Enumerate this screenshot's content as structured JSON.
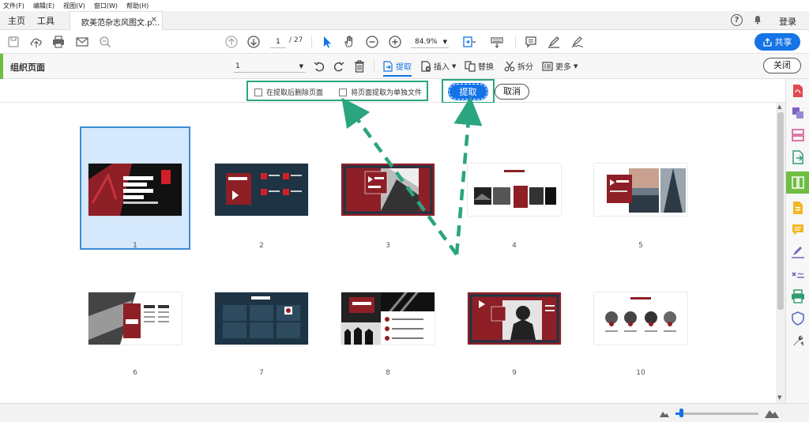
{
  "menu": [
    "文件(F)",
    "编辑(E)",
    "视图(V)",
    "窗口(W)",
    "帮助(H)"
  ],
  "tabs": {
    "home": "主页",
    "tools": "工具",
    "doc": "欧美范杂志风图文.p..."
  },
  "header": {
    "login": "登录"
  },
  "toolbar": {
    "page_current": "1",
    "page_total": "/ 27",
    "zoom": "84.9%",
    "share": "共享"
  },
  "organize": {
    "title": "组织页面",
    "page_select": "1",
    "tools": {
      "extract": "提取",
      "insert": "插入",
      "replace": "替换",
      "split": "拆分",
      "more": "更多"
    },
    "close": "关闭"
  },
  "extract_options": {
    "delete_after": "在提取后删除页面",
    "separate_files": "将页面提取为单独文件",
    "extract_btn": "提取",
    "cancel_btn": "取消"
  },
  "thumbnails": [
    "1",
    "2",
    "3",
    "4",
    "5",
    "6",
    "7",
    "8",
    "9",
    "10"
  ],
  "colors": {
    "accent": "#1473e6",
    "green": "#6ebe44",
    "annot": "#2aa57f",
    "red": "#8e1f26",
    "navy": "#1e3445"
  }
}
